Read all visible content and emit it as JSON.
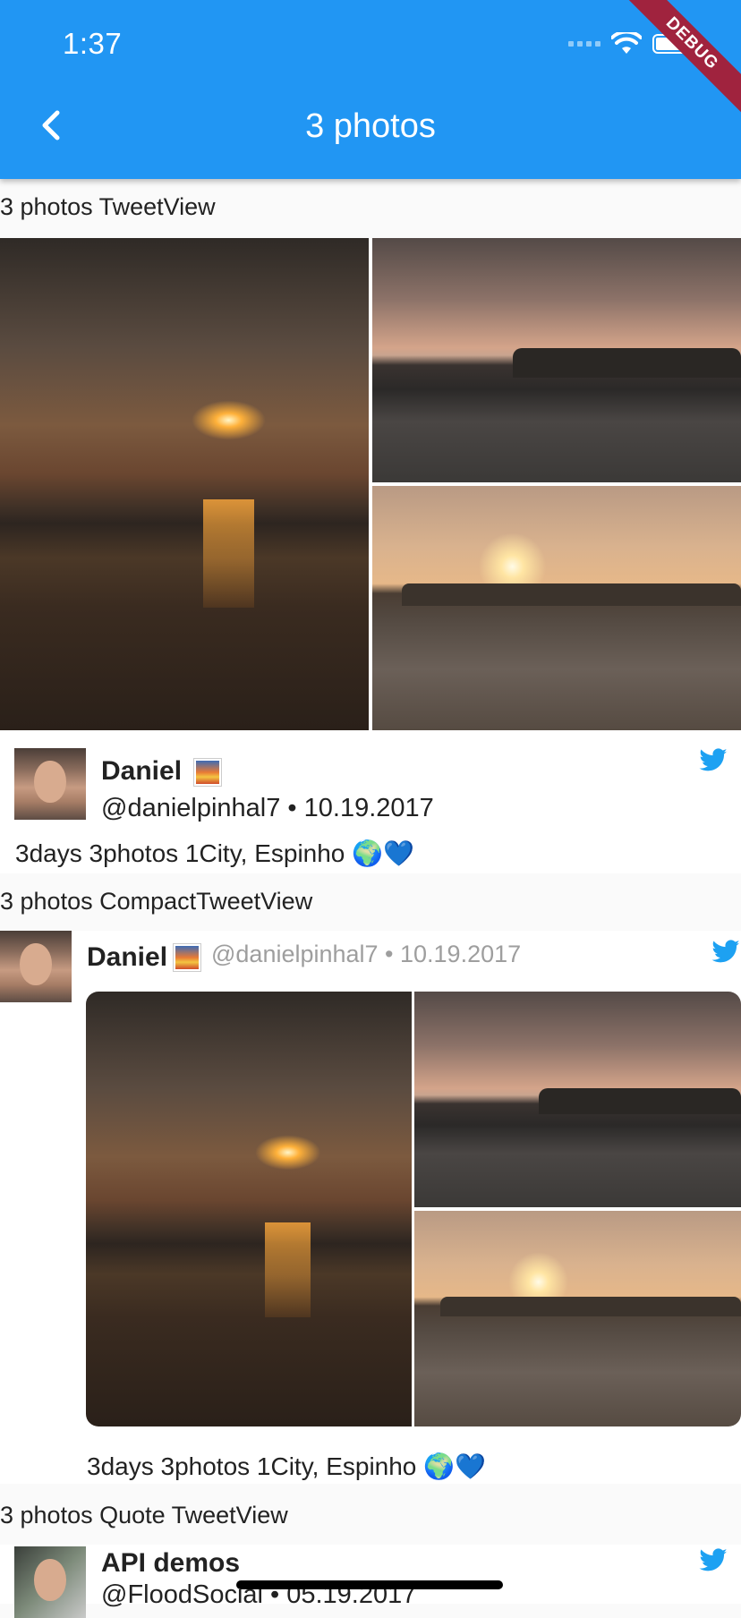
{
  "status_bar": {
    "time": "1:37"
  },
  "debug_banner": "DEBUG",
  "app_bar": {
    "title": "3 photos",
    "back_icon": "chevron-left-icon"
  },
  "sections": {
    "tweet_view_label": "3 photos TweetView",
    "compact_view_label": "3 photos CompactTweetView",
    "quote_view_label": "3 photos Quote TweetView"
  },
  "tweet": {
    "name": "Daniel",
    "handle_line": "@danielpinhal7 • 10.19.2017",
    "handle": "@danielpinhal7",
    "date_sep": "• 10.19.2017",
    "text": "3days 3photos 1City, Espinho 🌍💙"
  },
  "quote_tweet": {
    "name": "API demos",
    "handle_line": "@FloodSocial • 05.19.2017"
  },
  "colors": {
    "app_bar": "#2196f3",
    "twitter_blue": "#1da1f2"
  }
}
